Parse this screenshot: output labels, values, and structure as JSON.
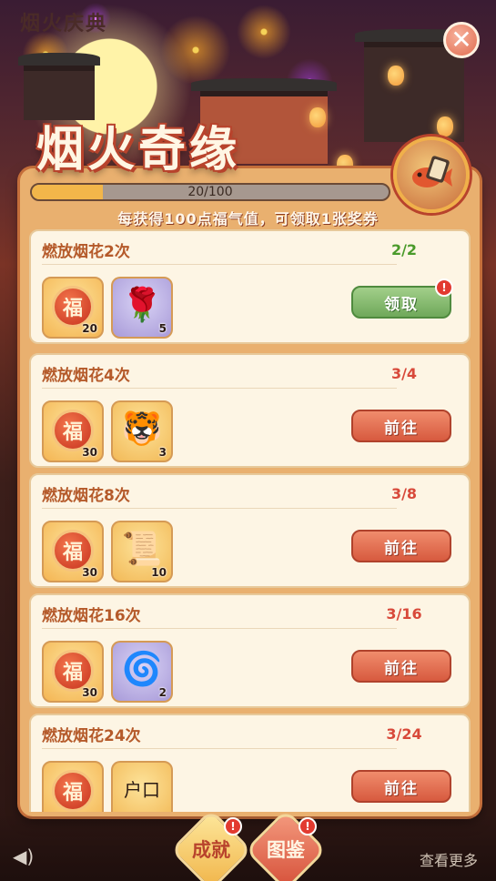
{
  "header": {
    "page_title": "烟火庆典",
    "event_logo": "烟火奇缘",
    "close_icon": "close-icon"
  },
  "progress": {
    "current": 20,
    "max": 100,
    "label": "20/100",
    "hint": "每获得100点福气值，可领取1张奖券"
  },
  "tasks": [
    {
      "title": "燃放烟花2次",
      "progress": "2/2",
      "status": "done",
      "rewards": [
        {
          "icon": "fu-coin-icon",
          "glyph": "福",
          "count": "20",
          "kind": "fu"
        },
        {
          "icon": "rose-icon",
          "glyph": "🌹",
          "count": "5",
          "kind": "item"
        }
      ],
      "button": "领取",
      "button_kind": "claim"
    },
    {
      "title": "燃放烟花4次",
      "progress": "3/4",
      "status": "todo",
      "rewards": [
        {
          "icon": "fu-coin-icon",
          "glyph": "福",
          "count": "30",
          "kind": "fu"
        },
        {
          "icon": "tiger-figurine-icon",
          "glyph": "🐯",
          "count": "3",
          "kind": "paper"
        }
      ],
      "button": "前往",
      "button_kind": "goto"
    },
    {
      "title": "燃放烟花8次",
      "progress": "3/8",
      "status": "todo",
      "rewards": [
        {
          "icon": "fu-coin-icon",
          "glyph": "福",
          "count": "30",
          "kind": "fu"
        },
        {
          "icon": "scroll-icon",
          "glyph": "📜",
          "count": "10",
          "kind": "paper"
        }
      ],
      "button": "前往",
      "button_kind": "goto"
    },
    {
      "title": "燃放烟花16次",
      "progress": "3/16",
      "status": "todo",
      "rewards": [
        {
          "icon": "fu-coin-icon",
          "glyph": "福",
          "count": "30",
          "kind": "fu"
        },
        {
          "icon": "swirl-card-icon",
          "glyph": "🌀",
          "count": "2",
          "kind": "paper"
        }
      ],
      "button": "前往",
      "button_kind": "goto"
    },
    {
      "title": "燃放烟花24次",
      "progress": "3/24",
      "status": "todo",
      "rewards": [
        {
          "icon": "fu-coin-icon",
          "glyph": "福",
          "count": "",
          "kind": "fu"
        },
        {
          "icon": "household-register-icon",
          "glyph": "户口",
          "count": "",
          "kind": "paper"
        }
      ],
      "button": "前往",
      "button_kind": "goto"
    }
  ],
  "bottom": {
    "achievements": "成就",
    "collection": "图鉴",
    "more": "查看更多"
  },
  "colors": {
    "accent_red": "#d75a3f",
    "claim_green": "#6fa85a",
    "progress_done": "#4a9a2a",
    "progress_todo": "#d8493a",
    "card_bg": "#fdf5e4"
  }
}
